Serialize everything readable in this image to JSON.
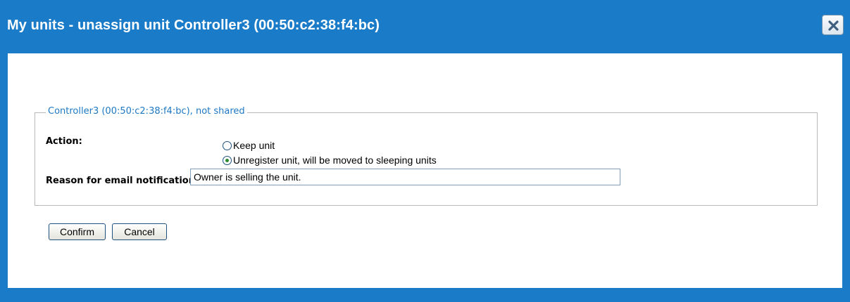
{
  "dialog": {
    "title": "My units - unassign unit Controller3 (00:50:c2:38:f4:bc)",
    "close_icon": "close-icon"
  },
  "form": {
    "legend": "Controller3 (00:50:c2:38:f4:bc), not shared",
    "action_label": "Action:",
    "options": [
      {
        "label": "Keep unit",
        "selected": false
      },
      {
        "label": "Unregister unit, will be moved to sleeping units",
        "selected": true
      }
    ],
    "reason_label": "Reason for email notification:",
    "reason_value": "Owner is selling the unit."
  },
  "buttons": {
    "confirm": "Confirm",
    "cancel": "Cancel"
  },
  "colors": {
    "title_bar": "#1a7bc8",
    "legend_text": "#1e78c3"
  }
}
